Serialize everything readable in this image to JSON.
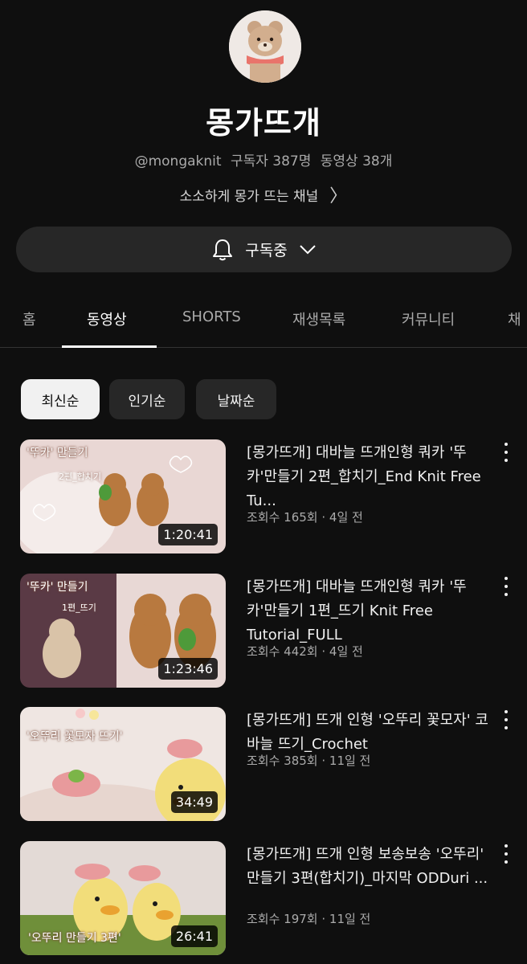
{
  "channel": {
    "name": "몽가뜨개",
    "handle": "@mongaknit",
    "subscribers": "구독자 387명",
    "video_count": "동영상 38개",
    "description": "소소하게 몽가 뜨는 채널"
  },
  "subscribe": {
    "label": "구독중"
  },
  "tabs": [
    "홈",
    "동영상",
    "SHORTS",
    "재생목록",
    "커뮤니티",
    "채"
  ],
  "active_tab": "동영상",
  "chips": [
    "최신순",
    "인기순",
    "날짜순"
  ],
  "active_chip": "최신순",
  "videos": [
    {
      "title": "[몽가뜨개] 대바늘 뜨개인형 쿼카 '뚜카'만들기 2편_합치기_End Knit Free Tu...",
      "stats": "조회수 165회 · 4일 전",
      "duration": "1:20:41",
      "thumb_caption": "'뚜카' 만들기",
      "thumb_sub": "2편_합치기"
    },
    {
      "title": "[몽가뜨개] 대바늘 뜨개인형 쿼카 '뚜카'만들기 1편_뜨기 Knit Free Tutorial_FULL",
      "stats": "조회수 442회 · 4일 전",
      "duration": "1:23:46",
      "thumb_caption": "'뚜카' 만들기",
      "thumb_sub": "1편_뜨기"
    },
    {
      "title": "[몽가뜨개] 뜨개 인형 '오뚜리 꽃모자' 코바늘 뜨기_Crochet",
      "stats": "조회수 385회 · 11일 전",
      "duration": "34:49",
      "thumb_caption": "'오뚜리 꽃모자 뜨기'",
      "thumb_sub": ""
    },
    {
      "title": "[몽가뜨개] 뜨개 인형 보송보송 '오뚜리' 만들기 3편(합치기)_마지막 ODDuri ...",
      "stats": "조회수 197회 · 11일 전",
      "duration": "26:41",
      "thumb_caption": "'오뚜리 만들기 3편'",
      "thumb_sub": ""
    }
  ],
  "icons": {
    "bell": "bell-icon",
    "chevron": "chevron-down-icon",
    "more": "more-vert-icon",
    "arrow": "chevron-right-icon"
  }
}
